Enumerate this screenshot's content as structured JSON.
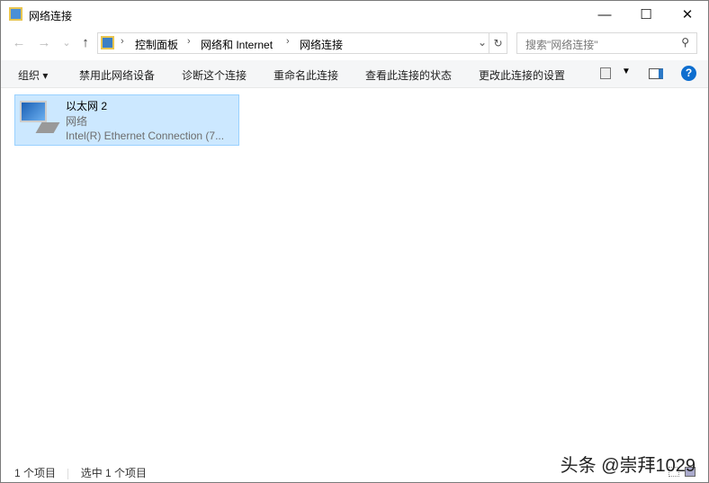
{
  "window": {
    "title": "网络连接",
    "minimize": "—",
    "maximize": "☐",
    "close": "✕"
  },
  "nav": {
    "back": "←",
    "forward": "→",
    "recent": "⌄",
    "up": "↑"
  },
  "address": {
    "crumbs": [
      "控制面板",
      "网络和 Internet",
      "网络连接"
    ],
    "dropdown": "⌄",
    "refresh": "↻"
  },
  "search": {
    "placeholder": "搜索\"网络连接\"",
    "icon": "⚲"
  },
  "toolbar": {
    "organize": "组织 ▾",
    "items": [
      "禁用此网络设备",
      "诊断这个连接",
      "重命名此连接",
      "查看此连接的状态",
      "更改此连接的设置"
    ],
    "help": "?"
  },
  "connection": {
    "name": "以太网 2",
    "status": "网络",
    "adapter": "Intel(R) Ethernet Connection (7..."
  },
  "statusbar": {
    "count": "1 个项目",
    "selected": "选中 1 个项目"
  },
  "watermark": "头条 @崇拜1029"
}
